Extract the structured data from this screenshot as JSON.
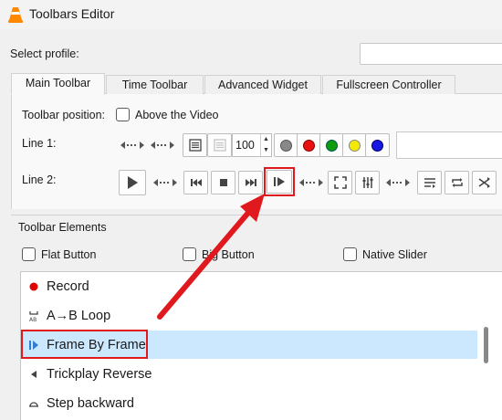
{
  "window": {
    "title": "Toolbars Editor"
  },
  "profile": {
    "label": "Select profile:",
    "value": ""
  },
  "tabs": [
    {
      "label": "Main Toolbar",
      "active": true
    },
    {
      "label": "Time Toolbar",
      "active": false
    },
    {
      "label": "Advanced Widget",
      "active": false
    },
    {
      "label": "Fullscreen Controller",
      "active": false
    }
  ],
  "toolbar_position": {
    "label": "Toolbar position:",
    "checkbox_label": "Above the Video",
    "checked": false
  },
  "line1": {
    "label": "Line 1:",
    "volume_value": "100"
  },
  "line2": {
    "label": "Line 2:"
  },
  "toolbar_elements": {
    "label": "Toolbar Elements",
    "flat_button": "Flat Button",
    "big_button": "Big Button",
    "native_slider": "Native Slider"
  },
  "elements_list": [
    {
      "label": "Record",
      "icon": "record-dot-icon"
    },
    {
      "label": "A→B Loop",
      "icon": "ab-loop-icon"
    },
    {
      "label": "Frame By Frame",
      "icon": "frame-by-frame-icon",
      "selected": true
    },
    {
      "label": "Trickplay Reverse",
      "icon": "trickplay-reverse-icon"
    },
    {
      "label": "Step backward",
      "icon": "step-backward-icon"
    }
  ],
  "colors": {
    "selection": "#cce8ff",
    "highlight_red": "#e0191e",
    "accent_blue": "#2f7fd0"
  }
}
